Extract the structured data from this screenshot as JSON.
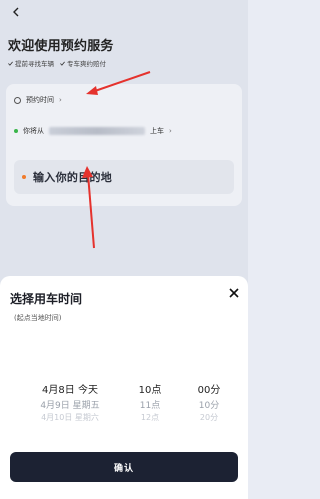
{
  "header": {
    "title": "欢迎使用预约服务",
    "features": [
      "提前寻找车辆",
      "专车爽约赔付"
    ]
  },
  "booking": {
    "time_label": "预约时间",
    "from_prefix": "你将从",
    "from_suffix": "上车",
    "destination_placeholder": "输入你的目的地"
  },
  "sheet": {
    "title": "选择用车时间",
    "subtitle": "(起点当地时间)",
    "picker": {
      "date": {
        "selected": "4月8日  今天",
        "next": "4月9日  星期五",
        "next2": "4月10日  星期六"
      },
      "hour": {
        "selected": "10点",
        "next": "11点",
        "next2": "12点"
      },
      "minute": {
        "selected": "00分",
        "next": "10分",
        "next2": "20分"
      }
    },
    "confirm_label": "确认"
  },
  "colors": {
    "accent_dark": "#1c2233",
    "arrow_red": "#e5322d",
    "dot_green": "#39b54a",
    "dot_orange": "#f07b2c"
  }
}
